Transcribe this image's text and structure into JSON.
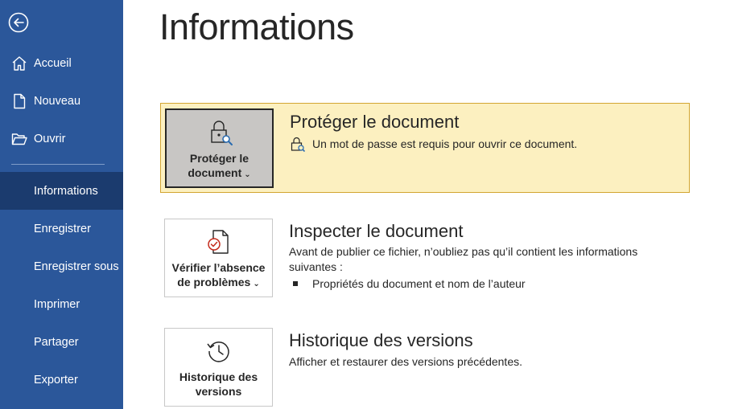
{
  "sidebar": {
    "back_label": "Retour",
    "items": [
      {
        "label": "Accueil",
        "icon": "home-icon"
      },
      {
        "label": "Nouveau",
        "icon": "new-document-icon"
      },
      {
        "label": "Ouvrir",
        "icon": "open-folder-icon"
      },
      {
        "label": "Informations",
        "active": true
      },
      {
        "label": "Enregistrer"
      },
      {
        "label": "Enregistrer sous"
      },
      {
        "label": "Imprimer"
      },
      {
        "label": "Partager"
      },
      {
        "label": "Exporter"
      }
    ]
  },
  "main": {
    "title": "Informations",
    "sections": [
      {
        "tile_label_line1": "Protéger le",
        "tile_label_line2": "document",
        "tile_icon": "lock-icon",
        "title": "Protéger le document",
        "description": "Un mot de passe est requis pour ouvrir ce document.",
        "description_icon": "password-protected-icon"
      },
      {
        "tile_label_line1": "Vérifier l’absence",
        "tile_label_line2": "de problèmes",
        "tile_icon": "check-document-icon",
        "title": "Inspecter le document",
        "description": "Avant de publier ce fichier, n’oubliez pas qu’il contient les informations suivantes :",
        "bullets": [
          "Propriétés du document et nom de l’auteur"
        ]
      },
      {
        "tile_label_line1": "Historique des",
        "tile_label_line2": "versions",
        "tile_icon": "version-history-icon",
        "title": "Historique des versions",
        "description": "Afficher et restaurer des versions précédentes."
      }
    ]
  },
  "colors": {
    "sidebar_bg": "#2b579a",
    "sidebar_active": "#1b3b6e",
    "highlight_bg": "#fcf0c0",
    "highlight_border": "#d3a531"
  }
}
